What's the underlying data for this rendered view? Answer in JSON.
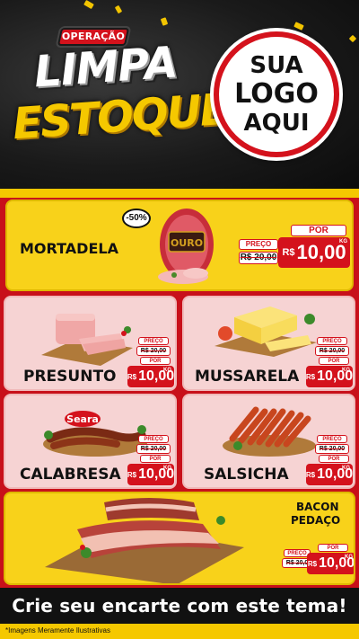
{
  "header": {
    "badge": "OPERAÇÃO",
    "title_line1": "LIMPA",
    "title_line2": "ESTOQUE",
    "logo_line1": "SUA",
    "logo_line2": "LOGO",
    "logo_line3": "AQUI"
  },
  "colors": {
    "brand_red": "#d4121c",
    "brand_yellow": "#f5c800",
    "dark": "#111111"
  },
  "products": {
    "mortadela": {
      "name": "MORTADELA",
      "discount": "-50%",
      "brand": "OURO",
      "old_label": "PREÇO",
      "old_price": "R$ 20,00",
      "new_label": "POR",
      "currency": "R$",
      "price": "10,00",
      "unit": "KG"
    },
    "presunto": {
      "name": "PRESUNTO",
      "old_label": "PREÇO",
      "old_price": "R$ 20,00",
      "new_label": "POR",
      "currency": "R$",
      "price": "10,00",
      "unit": "KG"
    },
    "mussarela": {
      "name": "MUSSARELA",
      "old_label": "PREÇO",
      "old_price": "R$ 20,00",
      "new_label": "POR",
      "currency": "R$",
      "price": "10,00",
      "unit": "KG"
    },
    "calabresa": {
      "name": "CALABRESA",
      "brand": "Seara",
      "old_label": "PREÇO",
      "old_price": "R$ 20,00",
      "new_label": "POR",
      "currency": "R$",
      "price": "10,00",
      "unit": "KG"
    },
    "salsicha": {
      "name": "SALSICHA",
      "old_label": "PREÇO",
      "old_price": "R$ 20,00",
      "new_label": "POR",
      "currency": "R$",
      "price": "10,00",
      "unit": "KG"
    },
    "bacon": {
      "name_line1": "BACON",
      "name_line2": "PEDAÇO",
      "old_label": "PREÇO",
      "old_price": "R$ 20,00",
      "new_label": "POR",
      "currency": "R$",
      "price": "10,00",
      "unit": "KG"
    }
  },
  "cta": {
    "text": "Crie seu encarte com este tema!"
  },
  "footer": {
    "note": "*Imagens Meramente Ilustrativas"
  }
}
